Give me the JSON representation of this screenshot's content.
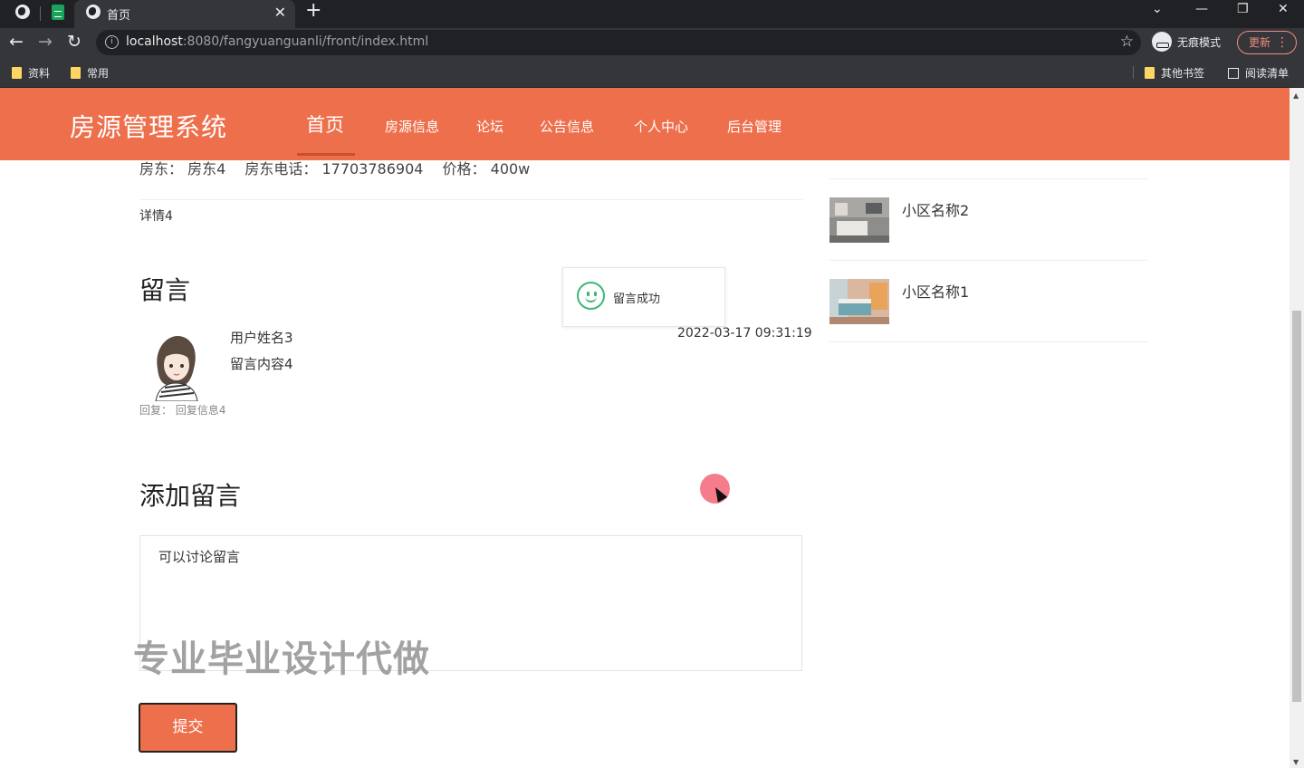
{
  "browser": {
    "tab_title": "首页",
    "url_host": "localhost",
    "url_path": ":8080/fangyuanguanli/front/index.html",
    "incognito_label": "无痕模式",
    "update_label": "更新",
    "bookmarks": [
      "资料",
      "常用"
    ],
    "bookmarks_right": [
      "其他书签",
      "阅读清单"
    ]
  },
  "header": {
    "site_title": "房源管理系统",
    "nav": [
      "首页",
      "房源信息",
      "论坛",
      "公告信息",
      "个人中心",
      "后台管理"
    ]
  },
  "detail": {
    "landlord": "房东：  房东4",
    "phone": "房东电话：  17703786904",
    "price": "价格：  400w",
    "text": "详情4"
  },
  "comments": {
    "heading": "留言",
    "items": [
      {
        "user": "用户姓名3",
        "content": "留言内容4",
        "time": "2022-03-17 09:31:19",
        "reply": "回复：  回复信息4"
      }
    ]
  },
  "toast": {
    "text": "留言成功"
  },
  "sidebar": {
    "items": [
      {
        "name": "小区名称2"
      },
      {
        "name": "小区名称1"
      }
    ]
  },
  "add_comment": {
    "heading": "添加留言",
    "value": "可以讨论留言",
    "submit_label": "提交"
  },
  "watermark": "专业毕业设计代做",
  "colors": {
    "brand": "#ee6f4c",
    "success": "#3cb878"
  }
}
